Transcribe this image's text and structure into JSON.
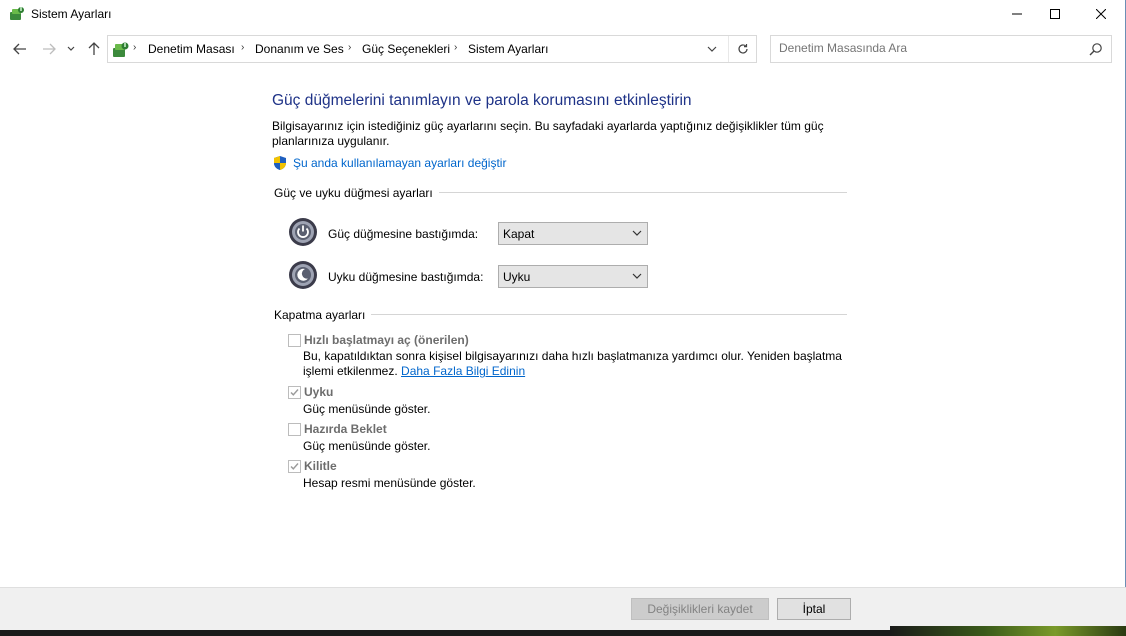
{
  "window": {
    "title": "Sistem Ayarları",
    "minimize_glyph": "—",
    "maximize_glyph": "☐",
    "close_glyph": "✕"
  },
  "nav": {
    "breadcrumbs": [
      "Denetim Masası",
      "Donanım ve Ses",
      "Güç Seçenekleri",
      "Sistem Ayarları"
    ],
    "search_placeholder": "Denetim Masasında Ara"
  },
  "page": {
    "heading": "Güç düğmelerini tanımlayın ve parola korumasını etkinleştirin",
    "description": "Bilgisayarınız için istediğiniz güç ayarlarını seçin. Bu sayfadaki ayarlarda yaptığınız değişiklikler tüm güç planlarınıza uygulanır.",
    "admin_link": "Şu anda kullanılamayan ayarları değiştir"
  },
  "power_section": {
    "label": "Güç ve uyku düğmesi ayarları",
    "power_button": {
      "label": "Güç düğmesine bastığımda:",
      "value": "Kapat"
    },
    "sleep_button": {
      "label": "Uyku düğmesine bastığımda:",
      "value": "Uyku"
    }
  },
  "shutdown_section": {
    "label": "Kapatma ayarları",
    "fast_startup": {
      "label": "Hızlı başlatmayı aç (önerilen)",
      "checked": false,
      "desc": "Bu, kapatıldıktan sonra kişisel bilgisayarınızı daha hızlı başlatmanıza yardımcı olur. Yeniden başlatma işlemi etkilenmez.",
      "link": "Daha Fazla Bilgi Edinin"
    },
    "sleep": {
      "label": "Uyku",
      "checked": true,
      "desc": "Güç menüsünde göster."
    },
    "hibernate": {
      "label": "Hazırda Beklet",
      "checked": false,
      "desc": "Güç menüsünde göster."
    },
    "lock": {
      "label": "Kilitle",
      "checked": true,
      "desc": "Hesap resmi menüsünde göster."
    }
  },
  "footer": {
    "save_label": "Değişiklikleri kaydet",
    "cancel_label": "İptal"
  }
}
